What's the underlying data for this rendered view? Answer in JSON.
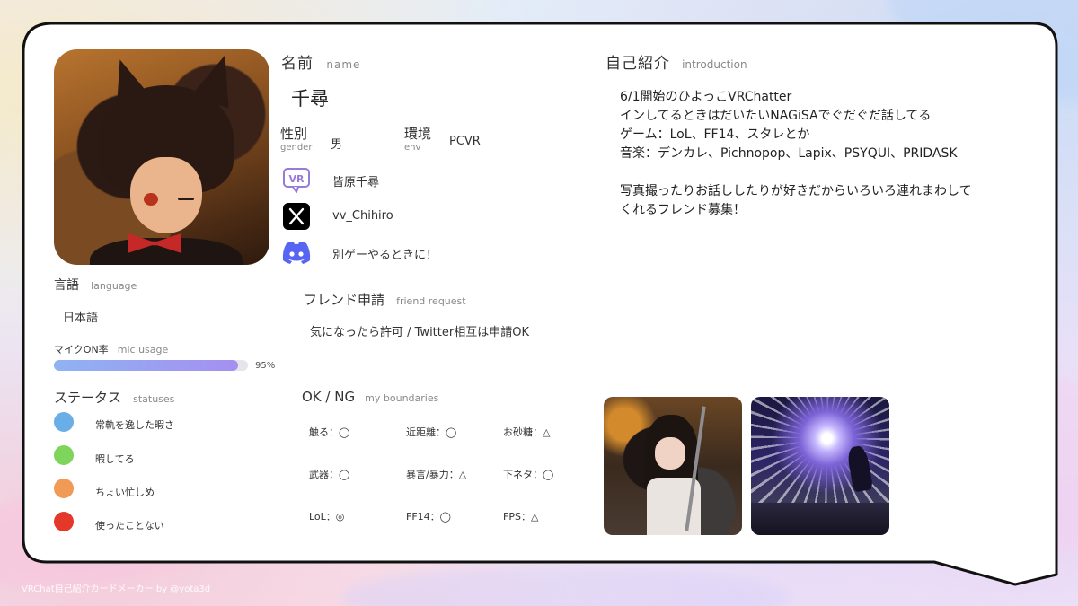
{
  "profile": {
    "name_label_jp": "名前",
    "name_label_en": "name",
    "name_value": "千尋",
    "gender_label_jp": "性別",
    "gender_label_en": "gender",
    "gender_value": "男",
    "env_label_jp": "環境",
    "env_label_en": "env",
    "env_value": "PCVR",
    "vrchat_id": "皆原千尋",
    "twitter_id": "vv_Chihiro",
    "discord_note": "別ゲーやるときに！"
  },
  "friend_request": {
    "label_jp": "フレンド申請",
    "label_en": "friend request",
    "value": "気になったら許可 / Twitter相互は申請OK"
  },
  "language": {
    "label_jp": "言語",
    "label_en": "language",
    "value": "日本語"
  },
  "mic": {
    "label_jp": "マイクON率",
    "label_en": "mic usage",
    "percent_text": "95%",
    "fraction": 0.95
  },
  "statuses": {
    "label_jp": "ステータス",
    "label_en": "statuses",
    "items": [
      {
        "color": "#6aaee8",
        "label": "常軌を逸した暇さ"
      },
      {
        "color": "#7fd45c",
        "label": "暇してる"
      },
      {
        "color": "#ef9a55",
        "label": "ちょい忙しめ"
      },
      {
        "color": "#e4382a",
        "label": "使ったことない"
      }
    ]
  },
  "boundaries": {
    "label_jp": "OK / NG",
    "label_en": "my boundaries",
    "items": [
      "触る：◯",
      "近距離：◯",
      "お砂糖：△",
      "武器：◯",
      "暴言/暴力：△",
      "下ネタ：◯",
      "LoL：◎",
      "FF14：◯",
      "FPS：△"
    ]
  },
  "intro": {
    "label_jp": "自己紹介",
    "label_en": "introduction",
    "lines": [
      "6/1開始のひよっこVRChatter",
      "インしてるときはだいたいNAGiSAでぐだぐだ話してる",
      "ゲーム：LoL、FF14、スタレとか",
      "音楽：デンカレ、Pichnopop、Lapix、PSYQUI、PRIDASK",
      "",
      "写真撮ったりお話ししたりが好きだからいろいろ連れまわして",
      "くれるフレンド募集！"
    ]
  },
  "footer": "VRChat自己紹介カードメーカー by @yota3d",
  "icons": {
    "vrchat": "vrchat-icon",
    "twitter": "x-twitter-icon",
    "discord": "discord-icon"
  },
  "colors": {
    "card_border": "#111111",
    "card_bg": "#ffffff",
    "bar_start": "#8fb3f2",
    "bar_end": "#a58ff0"
  }
}
